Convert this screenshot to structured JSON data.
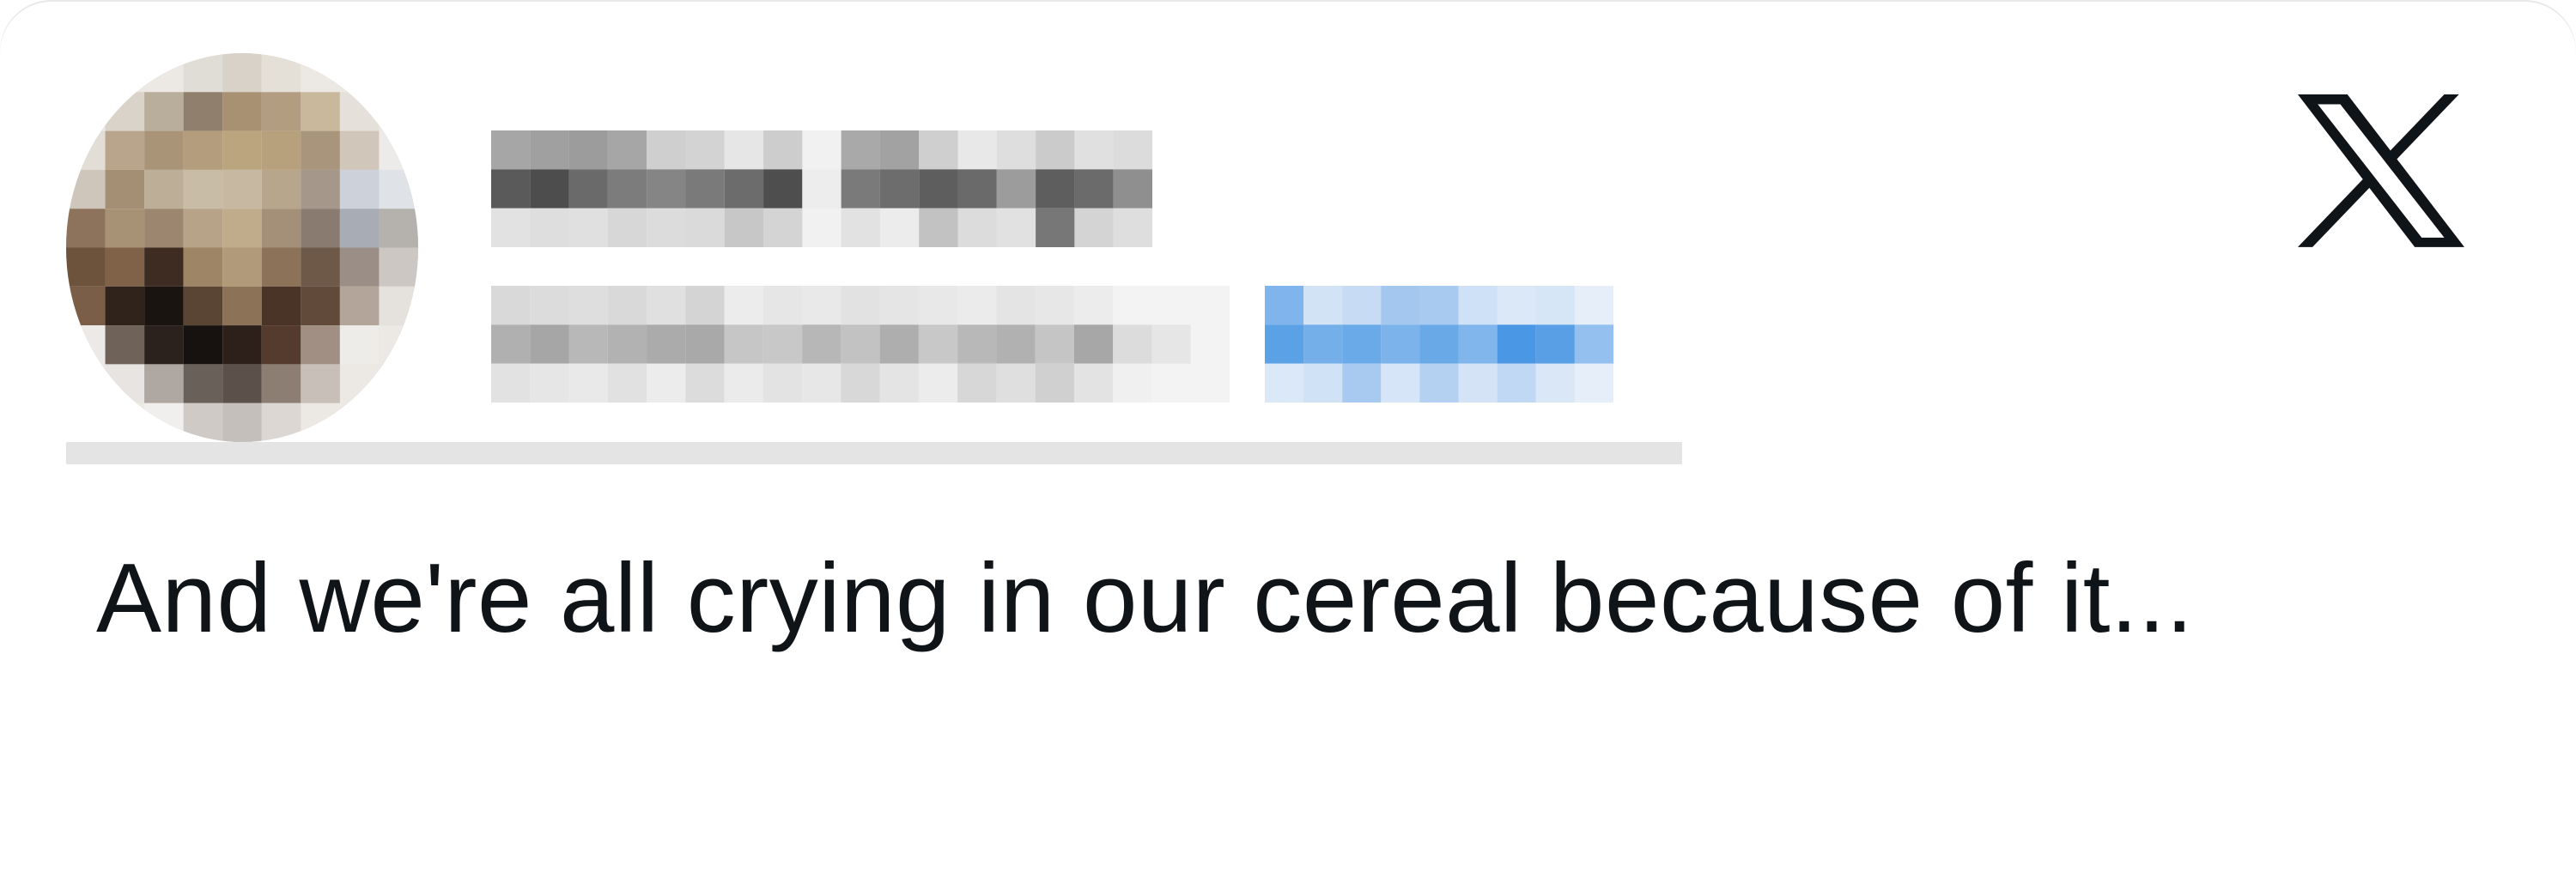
{
  "tweet": {
    "text": "And we're all crying in our cereal because of it..."
  },
  "author": {
    "name_redacted": true,
    "handle_redacted": true
  },
  "icons": {
    "platform_logo": "x-logo-icon",
    "avatar": "avatar-icon"
  },
  "colors": {
    "text": "#0f1419",
    "link": "#4c9be8",
    "logo": "#0f1419",
    "divider": "#e4e4e4"
  }
}
